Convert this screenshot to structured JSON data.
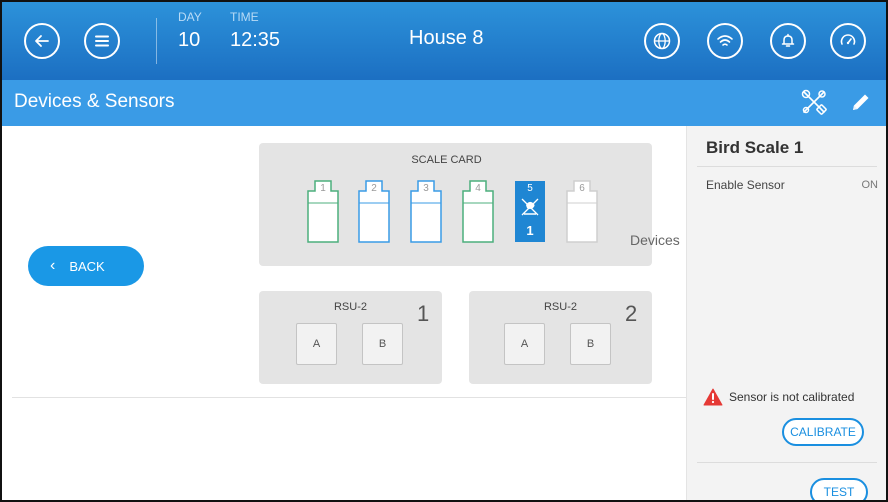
{
  "header": {
    "day_label": "DAY",
    "day_value": "10",
    "time_label": "TIME",
    "time_value": "12:35",
    "house": "House 8",
    "icons": [
      "back-arrow-icon",
      "menu-icon",
      "globe-icon",
      "wifi-icon",
      "bell-icon",
      "gauge-icon"
    ]
  },
  "section": {
    "title": "Devices & Sensors",
    "icons": [
      "tools-icon",
      "pencil-icon"
    ]
  },
  "main": {
    "back_label": "BACK",
    "devices_text": "Devices",
    "scale_card": {
      "title": "SCALE CARD",
      "slots": [
        {
          "number": "1",
          "state": "green"
        },
        {
          "number": "2",
          "state": "blue"
        },
        {
          "number": "3",
          "state": "blue"
        },
        {
          "number": "4",
          "state": "green"
        },
        {
          "number": "5",
          "state": "active",
          "device_number": "1"
        },
        {
          "number": "6",
          "state": "empty"
        }
      ]
    },
    "rsu_cards": [
      {
        "title": "RSU-2",
        "number": "1",
        "inputs": [
          "A",
          "B"
        ]
      },
      {
        "title": "RSU-2",
        "number": "2",
        "inputs": [
          "A",
          "B"
        ]
      }
    ]
  },
  "panel": {
    "title": "Bird Scale 1",
    "enable_label": "Enable Sensor",
    "enable_value": "ON",
    "warning": "Sensor is not calibrated",
    "calibrate_label": "CALIBRATE",
    "test_label": "TEST"
  },
  "colors": {
    "topbar": "#1f78c8",
    "section_bar": "#3a9be6",
    "accent": "#1a98e6",
    "slot_green": "#4caf7d",
    "slot_blue": "#3a9be6",
    "warning": "#e53935"
  }
}
